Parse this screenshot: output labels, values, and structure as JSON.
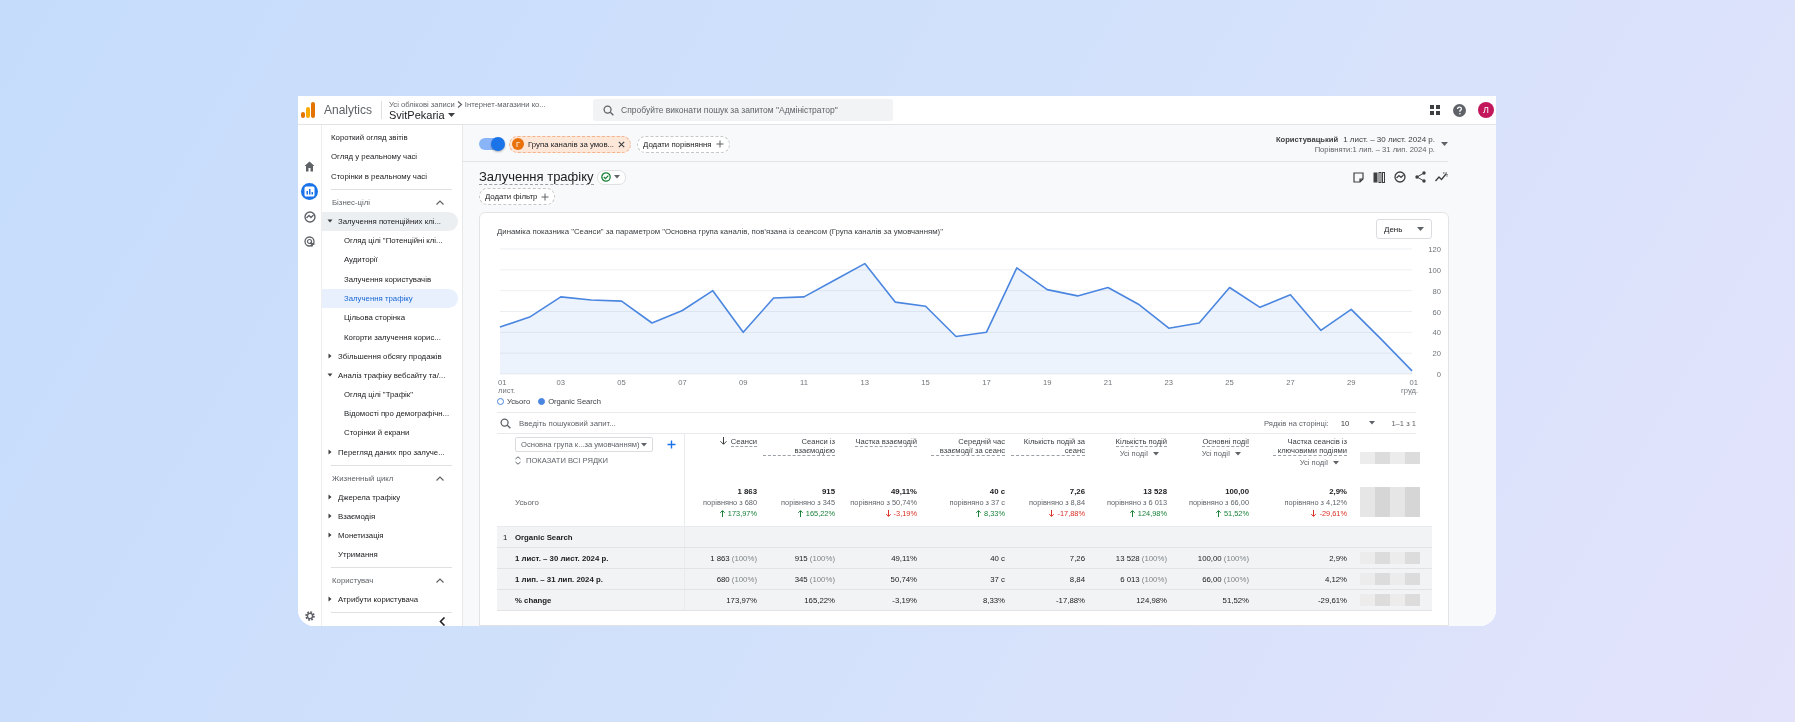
{
  "topbar": {
    "product": "Analytics",
    "breadcrumb": [
      "Усі облікові записи",
      "Інтернет-магазини ко..."
    ],
    "property": "SvitPekaria",
    "search": {
      "placeholder": "Спробуйте виконати пошук за запитом \"Адміністратор\""
    },
    "avatar": "Л"
  },
  "rail": [
    {
      "selected": false
    },
    {
      "selected": true
    },
    {
      "selected": false
    },
    {
      "selected": false
    }
  ],
  "sidebar": {
    "top_items": [
      {
        "label": "Короткий огляд звітів",
        "selected": false
      },
      {
        "label": "Огляд у реальному часі",
        "selected": false
      },
      {
        "label": "Сторінки в реальному часі",
        "selected": false
      }
    ],
    "sections": [
      {
        "title": "Бізнес-цілі",
        "expanded": true,
        "items": [
          {
            "label": "Залучення потенційних клі...",
            "selected": false,
            "expanded": true,
            "children": [
              {
                "label": "Огляд цілі \"Потенційні клі...",
                "selected": false
              },
              {
                "label": "Аудиторії",
                "selected": false
              },
              {
                "label": "Залучення користувачів",
                "selected": false
              },
              {
                "label": "Залучення трафіку",
                "selected": true
              },
              {
                "label": "Цільова сторінка",
                "selected": false
              },
              {
                "label": "Когорти залучення корис...",
                "selected": false
              }
            ]
          },
          {
            "label": "Збільшення обсягу продажів",
            "selected": false,
            "expanded": false
          },
          {
            "label": "Аналіз трафіку вебсайту та/...",
            "selected": false,
            "expanded": true,
            "children": [
              {
                "label": "Огляд цілі \"Трафік\"",
                "selected": false
              },
              {
                "label": "Відомості про демографічн...",
                "selected": false
              },
              {
                "label": "Сторінки й екрани",
                "selected": false
              }
            ]
          },
          {
            "label": "Перегляд даних про залуче...",
            "selected": false,
            "expanded": false
          }
        ]
      },
      {
        "title": "Жизненный цикл",
        "expanded": true,
        "items": [
          {
            "label": "Джерела трафіку",
            "selected": false,
            "expanded": false
          },
          {
            "label": "Взаємодія",
            "selected": false,
            "expanded": false
          },
          {
            "label": "Монетизація",
            "selected": false,
            "expanded": false
          },
          {
            "label": "Утримання",
            "selected": false
          }
        ]
      },
      {
        "title": "Користувач",
        "expanded": true,
        "items": [
          {
            "label": "Атрибути користувача",
            "selected": false,
            "expanded": false
          }
        ]
      }
    ]
  },
  "toolbar": {
    "comparison_toggle": {
      "on": true
    },
    "comparison_chip": {
      "initial": "Г",
      "label": "Група каналів за умов..."
    },
    "add_comparison": "Додати порівняння",
    "date_range": {
      "label": "Користувацький",
      "range": "1 лист. – 30 лист. 2024 р.",
      "compare": "Порівняти:1 лип. – 31 лип. 2024 р."
    }
  },
  "report": {
    "title": "Залучення трафіку",
    "add_filter": "Додати фільтр"
  },
  "chart_card": {
    "interval": "День",
    "chart_data": {
      "type": "area",
      "title": "Динаміка показника \"Сеанси\" за параметром \"Основна група каналів, пов’язана із сеансом (Група каналів за умовчанням)\"",
      "categories": [
        "01 лист.",
        null,
        "03",
        null,
        "05",
        null,
        "07",
        null,
        "09",
        null,
        "11",
        null,
        "13",
        null,
        "15",
        null,
        "17",
        null,
        "19",
        null,
        "21",
        null,
        "23",
        null,
        "25",
        null,
        "27",
        null,
        "29",
        null,
        "01 груд."
      ],
      "grid": true,
      "series": [
        {
          "name": "Organic Search",
          "color": "#4a86e0",
          "values": [
            45,
            55,
            74,
            71,
            70,
            49,
            61,
            80,
            40,
            73,
            74,
            90,
            106,
            69,
            65,
            36,
            40,
            102,
            81,
            75,
            83,
            67,
            44,
            49,
            83,
            64,
            76,
            42,
            62,
            33,
            3
          ]
        }
      ],
      "ylim": [
        0,
        120
      ],
      "yticks": [
        0,
        20,
        40,
        60,
        80,
        100,
        120
      ]
    },
    "legend": [
      {
        "label": "Усього",
        "filled": false
      }
    ]
  },
  "table": {
    "search": {
      "placeholder": "Введіть пошуковий запит..."
    },
    "rows_per_page_label": "Рядків на сторінці:",
    "rows_per_page": "10",
    "pagination": "1–1 з 1",
    "dimension": "Основна група к...за умовчанням)",
    "show_all_rows": "ПОКАЗАТИ ВСІ РЯДКИ",
    "columns": [
      {
        "label": "Сеанси",
        "sorted": true
      },
      {
        "label": "Сеанси із взаємодією",
        "sorted": false
      },
      {
        "label": "Частка взаємодій",
        "sorted": false
      },
      {
        "label": "Середній час взаємодії за сеанс",
        "sorted": false
      },
      {
        "label": "Кількість подій за сеанс",
        "sorted": false
      },
      {
        "label": "Кількість подій",
        "sorted": false,
        "event_filter": "Усі події"
      },
      {
        "label": "Основні події",
        "sorted": false,
        "event_filter": "Усі події"
      },
      {
        "label": "Частка сеансів із ключовими подіями",
        "sorted": false,
        "event_filter": "Усі події"
      }
    ],
    "totals": {
      "label": "Усього",
      "cells": [
        {
          "value": "1 863",
          "compare": "порівняно з 680",
          "change": "173,97%",
          "kind": "up"
        },
        {
          "value": "915",
          "compare": "порівняно з 345",
          "change": "165,22%",
          "kind": "up"
        },
        {
          "value": "49,11%",
          "compare": "порівняно з 50,74%",
          "change": "-3,19%",
          "kind": "down"
        },
        {
          "value": "40 с",
          "compare": "порівняно з 37 с",
          "change": "8,33%",
          "kind": "up"
        },
        {
          "value": "7,26",
          "compare": "порівняно з 8,84",
          "change": "-17,88%",
          "kind": "down"
        },
        {
          "value": "13 528",
          "compare": "порівняно з 6 013",
          "change": "124,98%",
          "kind": "up"
        },
        {
          "value": "100,00",
          "compare": "порівняно з 66,00",
          "change": "51,52%",
          "kind": "up"
        },
        {
          "value": "2,9%",
          "compare": "порівняно з 4,12%",
          "change": "-29,61%",
          "kind": "down"
        }
      ]
    },
    "rows": [
      {
        "kind": "group",
        "index": "1",
        "label": "Organic Search"
      },
      {
        "kind": "data",
        "label": "1 лист. – 30 лист. 2024 р.",
        "cells": [
          {
            "value": "1 863",
            "share": "(100%)"
          },
          {
            "value": "915",
            "share": "(100%)"
          },
          {
            "value": "49,11%"
          },
          {
            "value": "40 с"
          },
          {
            "value": "7,26"
          },
          {
            "value": "13 528",
            "share": "(100%)"
          },
          {
            "value": "100,00",
            "share": "(100%)"
          },
          {
            "value": "2,9%"
          }
        ]
      },
      {
        "kind": "data",
        "label": "1 лип. – 31 лип. 2024 р.",
        "cells": [
          {
            "value": "680",
            "share": "(100%)"
          },
          {
            "value": "345",
            "share": "(100%)"
          },
          {
            "value": "50,74%"
          },
          {
            "value": "37 с"
          },
          {
            "value": "8,84"
          },
          {
            "value": "6 013",
            "share": "(100%)"
          },
          {
            "value": "66,00",
            "share": "(100%)"
          },
          {
            "value": "4,12%"
          }
        ]
      },
      {
        "kind": "data",
        "label": "% change",
        "cells": [
          {
            "value": "173,97%"
          },
          {
            "value": "165,22%"
          },
          {
            "value": "-3,19%"
          },
          {
            "value": "8,33%"
          },
          {
            "value": "-17,88%"
          },
          {
            "value": "124,98%"
          },
          {
            "value": "51,52%"
          },
          {
            "value": "-29,61%"
          }
        ]
      }
    ]
  }
}
